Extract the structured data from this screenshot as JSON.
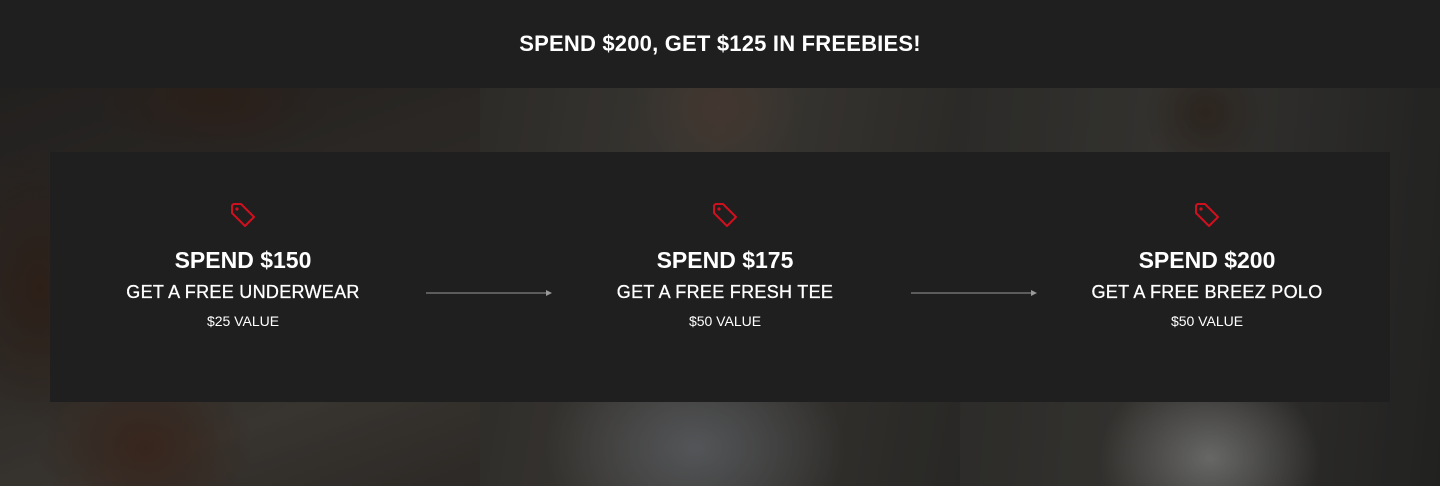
{
  "banner": {
    "title": "SPEND $200, GET $125 IN FREEBIES!"
  },
  "tiers": [
    {
      "spend": "SPEND $150",
      "reward": "GET A FREE UNDERWEAR",
      "value": "$25 VALUE",
      "icon": "tag-icon"
    },
    {
      "spend": "SPEND $175",
      "reward": "GET A FREE FRESH TEE",
      "value": "$50 VALUE",
      "icon": "tag-icon"
    },
    {
      "spend": "SPEND $200",
      "reward": "GET A FREE BREEZ POLO",
      "value": "$50 VALUE",
      "icon": "tag-icon"
    }
  ],
  "colors": {
    "background": "#1f1f1f",
    "accent": "#d0101e",
    "text": "#ffffff",
    "arrow": "#9a9a9a"
  }
}
